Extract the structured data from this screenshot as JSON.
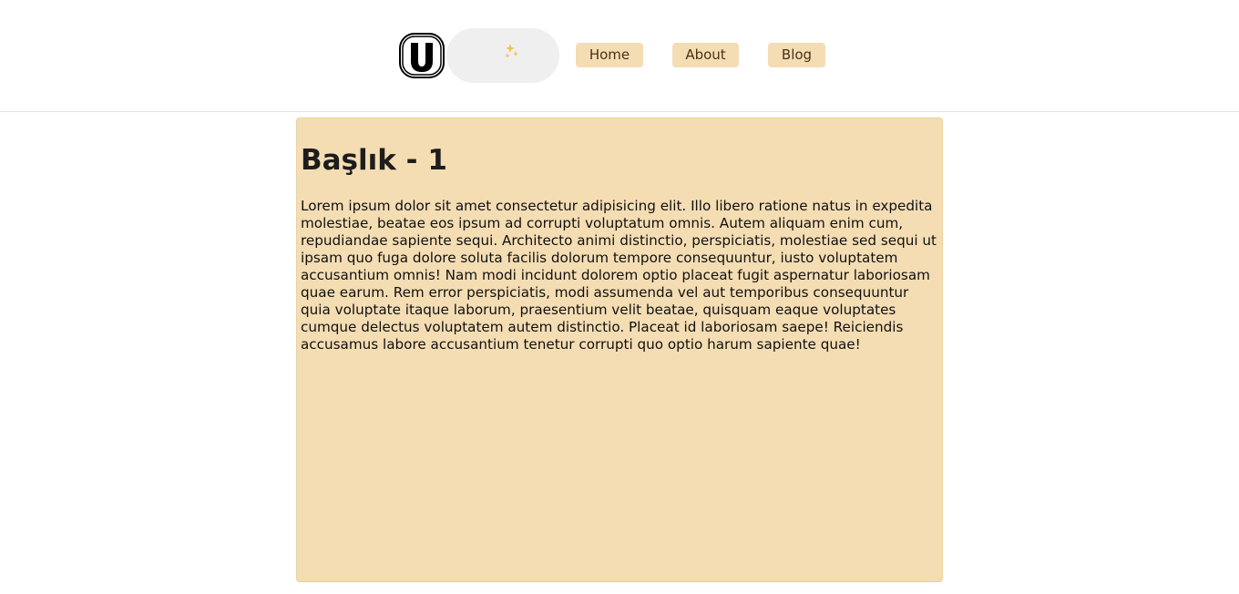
{
  "header": {
    "logo_icon": "u-logo-icon",
    "theme_toggle_icon": "moon-stars-icon",
    "nav": {
      "home": "Home",
      "about": "About",
      "blog": "Blog"
    }
  },
  "colors": {
    "accent": "#f4ddb3",
    "moon": "#f2c14e",
    "toggle_bg": "#efefef"
  },
  "main": {
    "title": "Başlık - 1",
    "body": "Lorem ipsum dolor sit amet consectetur adipisicing elit. Illo libero ratione natus in expedita molestiae, beatae eos ipsum ad corrupti voluptatum omnis. Autem aliquam enim cum, repudiandae sapiente sequi. Architecto animi distinctio, perspiciatis, molestiae sed sequi ut ipsam quo fuga dolore soluta facilis dolorum tempore consequuntur, iusto voluptatem accusantium omnis! Nam modi incidunt dolorem optio placeat fugit aspernatur laboriosam quae earum. Rem error perspiciatis, modi assumenda vel aut temporibus consequuntur quia voluptate itaque laborum, praesentium velit beatae, quisquam eaque voluptates cumque delectus voluptatem autem distinctio. Placeat id laboriosam saepe! Reiciendis accusamus labore accusantium tenetur corrupti quo optio harum sapiente quae!"
  }
}
